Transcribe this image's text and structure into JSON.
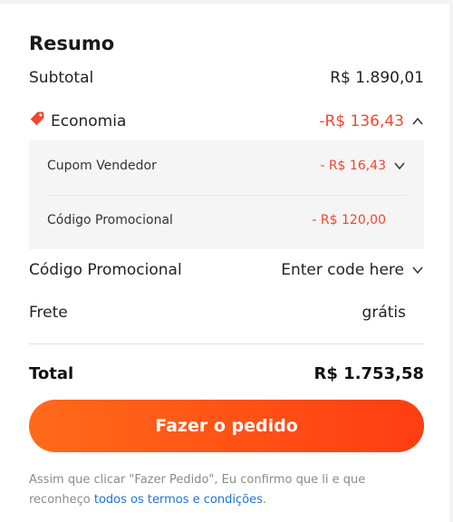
{
  "summary": {
    "title": "Resumo",
    "subtotal_label": "Subtotal",
    "subtotal_value": "R$ 1.890,01",
    "savings_label": "Economia",
    "savings_value": "-R$ 136,43",
    "breakdown": {
      "seller_coupon_label": "Cupom Vendedor",
      "seller_coupon_value": "- R$ 16,43",
      "promo_code_label": "Código Promocional",
      "promo_code_value": "- R$ 120,00"
    },
    "promo_field_label": "Código Promocional",
    "promo_field_placeholder": "Enter code here",
    "shipping_label": "Frete",
    "shipping_value": "grátis",
    "total_label": "Total",
    "total_value": "R$ 1.753,58"
  },
  "order_button_label": "Fazer o pedido",
  "terms": {
    "text": "Assim que clicar \"Fazer Pedido\", Eu confirmo que li e que reconheço ",
    "link": "todos os termos e condições",
    "suffix": "."
  },
  "colors": {
    "accent": "#ff4d14",
    "discount": "#f4452f",
    "link": "#1a73d9"
  },
  "icons": {
    "savings": "tag-icon",
    "expand_savings": "chevron-up-icon",
    "expand_coupon": "chevron-down-icon",
    "expand_promo": "chevron-down-icon"
  }
}
